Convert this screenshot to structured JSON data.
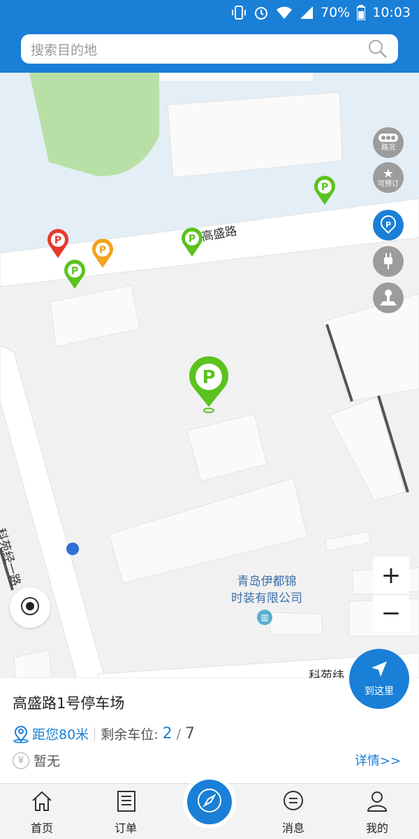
{
  "status_bar": {
    "battery": "70%",
    "time": "10:03"
  },
  "search": {
    "placeholder": "搜索目的地"
  },
  "map": {
    "roads": {
      "north": "高盛路",
      "west": "科苑经一路",
      "south": "科苑纬"
    },
    "poi": {
      "line1": "青岛伊都锦",
      "line2": "时装有限公司"
    }
  },
  "side_buttons": [
    {
      "icon": "traffic-icon",
      "label": "路况"
    },
    {
      "icon": "star-icon",
      "label": "可预订"
    },
    {
      "icon": "parking-icon",
      "label": ""
    },
    {
      "icon": "charging-plug-icon",
      "label": ""
    },
    {
      "icon": "person-pin-icon",
      "label": ""
    }
  ],
  "zoom": {
    "in": "+",
    "out": "−"
  },
  "goto_button": {
    "label": "到这里"
  },
  "parking_info": {
    "name": "高盛路1号停车场",
    "distance": "距您80米",
    "remaining_label": "剩余车位:",
    "remaining": "2",
    "slash": "/",
    "total": "7",
    "price": "暂无",
    "detail": "详情>>"
  },
  "tabs": {
    "home": "首页",
    "orders": "订单",
    "messages": "消息",
    "mine": "我的"
  },
  "colors": {
    "primary": "#1a7fd6",
    "pin_green": "#5bc21e",
    "pin_red": "#e53a2a",
    "pin_orange": "#f2a21c"
  }
}
